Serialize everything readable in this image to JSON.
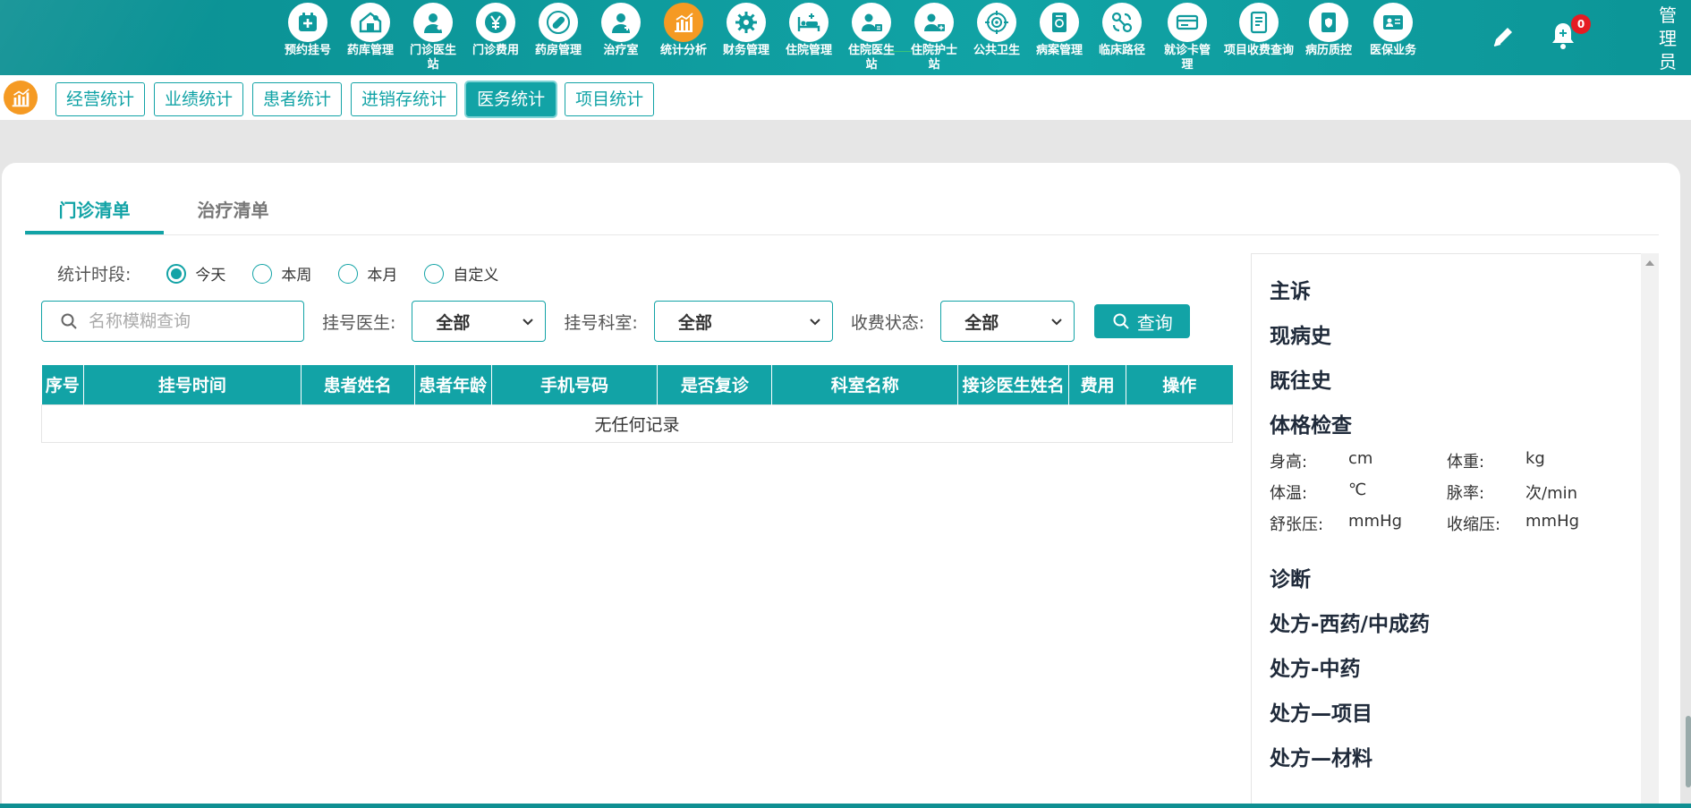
{
  "nav": {
    "items": [
      {
        "label": "预约挂号",
        "icon": "calendar-plus-icon"
      },
      {
        "label": "药库管理",
        "icon": "warehouse-icon"
      },
      {
        "label": "门诊医生站",
        "icon": "doctor-icon"
      },
      {
        "label": "门诊费用",
        "icon": "yen-icon"
      },
      {
        "label": "药房管理",
        "icon": "pill-icon"
      },
      {
        "label": "治疗室",
        "icon": "nurse-icon"
      },
      {
        "label": "统计分析",
        "icon": "chart-icon",
        "active": true
      },
      {
        "label": "财务管理",
        "icon": "gear-icon"
      },
      {
        "label": "住院管理",
        "icon": "bed-icon"
      },
      {
        "label": "住院医生站",
        "icon": "doctor-card-icon"
      },
      {
        "label": "住院护士站",
        "icon": "nurse-card-icon"
      },
      {
        "label": "公共卫生",
        "icon": "target-icon"
      },
      {
        "label": "病案管理",
        "icon": "record-icon"
      },
      {
        "label": "临床路径",
        "icon": "path-icon"
      },
      {
        "label": "就诊卡管理",
        "icon": "card-icon"
      },
      {
        "label": "项目收费查询",
        "icon": "receipt-icon"
      },
      {
        "label": "病历质控",
        "icon": "shield-doc-icon"
      },
      {
        "label": "医保业务",
        "icon": "id-card-icon"
      }
    ]
  },
  "header": {
    "notification_count": "0",
    "user": "管理员"
  },
  "subtabs": [
    "经营统计",
    "业绩统计",
    "患者统计",
    "进销存统计",
    "医务统计",
    "项目统计"
  ],
  "subtab_active_index": 4,
  "tabs": [
    "门诊清单",
    "治疗清单"
  ],
  "period": {
    "label": "统计时段:",
    "options": [
      "今天",
      "本周",
      "本月",
      "自定义"
    ],
    "selected": "今天"
  },
  "filters": {
    "search_placeholder": "名称模糊查询",
    "doctor_label": "挂号医生:",
    "doctor_value": "全部",
    "dept_label": "挂号科室:",
    "dept_value": "全部",
    "fee_label": "收费状态:",
    "fee_value": "全部",
    "query_label": "查询"
  },
  "table": {
    "columns": [
      "序号",
      "挂号时间",
      "患者姓名",
      "患者年龄",
      "手机号码",
      "是否复诊",
      "科室名称",
      "接诊医生姓名",
      "费用",
      "操作"
    ],
    "empty_text": "无任何记录"
  },
  "detail": {
    "sections_top": [
      "主诉",
      "现病史",
      "既往史",
      "体格检查"
    ],
    "vitals": [
      {
        "label": "身高:",
        "unit": "cm"
      },
      {
        "label": "体重:",
        "unit": "kg"
      },
      {
        "label": "体温:",
        "unit": "℃"
      },
      {
        "label": "脉率:",
        "unit": "次/min"
      },
      {
        "label": "舒张压:",
        "unit": "mmHg"
      },
      {
        "label": "收缩压:",
        "unit": "mmHg"
      }
    ],
    "sections_bottom": [
      "诊断",
      "处方-西药/中成药",
      "处方-中药",
      "处方—项目",
      "处方—材料"
    ]
  },
  "colors": {
    "primary": "#12a3a6",
    "active_nav": "#f59a23",
    "badge": "#e51c23"
  }
}
